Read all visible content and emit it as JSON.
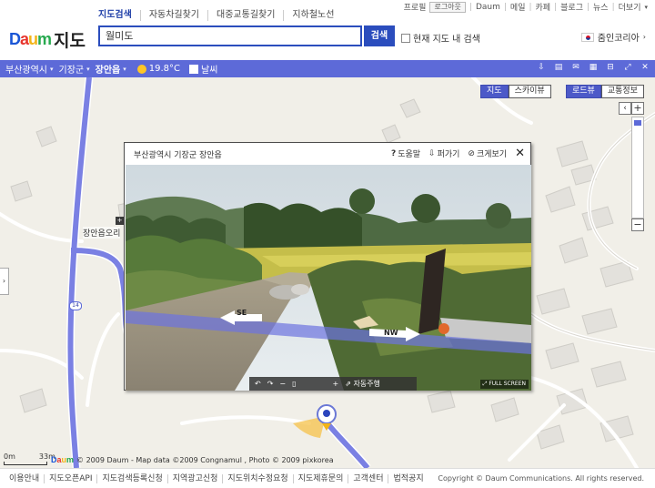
{
  "header": {
    "top_links": [
      "프로필",
      "Daum",
      "메일",
      "카페",
      "블로그",
      "뉴스",
      "더보기"
    ],
    "login_label": "로그아웃",
    "tabs": [
      "지도검색",
      "자동차길찾기",
      "대중교통길찾기",
      "지하철노선"
    ],
    "logo_brand": "Daum",
    "logo_title": "지도",
    "search_value": "월미도",
    "search_button": "검색",
    "local_search_label": "현재 지도 내 검색",
    "region_label": "줌인코리아"
  },
  "navbar": {
    "crumbs": [
      "부산광역시",
      "기장군",
      "장안읍"
    ],
    "temperature": "19.8°C",
    "weather_label": "날씨",
    "icons": [
      "download-icon",
      "print-icon",
      "mail-icon",
      "keyboard-icon",
      "link-icon",
      "fullscreen-icon",
      "close-icon"
    ]
  },
  "map": {
    "map_types": [
      "지도",
      "스카이뷰",
      "로드뷰",
      "교통정보"
    ],
    "active_types": [
      "지도",
      "로드뷰"
    ],
    "poi_label": "장안읍오리",
    "road_number": "14",
    "scale_labels": [
      "0m",
      "33m"
    ],
    "copyright": "© 2009 Daum - Map data ©2009 Congnamul , Photo © 2009 pixkorea",
    "zoom_in": "+",
    "zoom_out": "−"
  },
  "roadview": {
    "title": "부산광역시 기장군 장안읍",
    "tools": [
      "도움말",
      "퍼가기",
      "크게보기"
    ],
    "direction_left": "SE",
    "direction_right": "NW",
    "autoplay_label": "자동주행",
    "full_screen": "FULL SCREEN"
  },
  "footer": {
    "links": [
      "이용안내",
      "지도오픈API",
      "지도검색등록신청",
      "지역광고신청",
      "지도위치수정요청",
      "지도제휴문의",
      "고객센터",
      "법적공지"
    ],
    "copyright": "Copyright © Daum Communications. All rights reserved."
  },
  "colors": {
    "brand_blue": "#2b4dbd",
    "nav_bar": "#5d6ad8",
    "map_bg": "#f1efe8",
    "road": "#7a80e3"
  }
}
